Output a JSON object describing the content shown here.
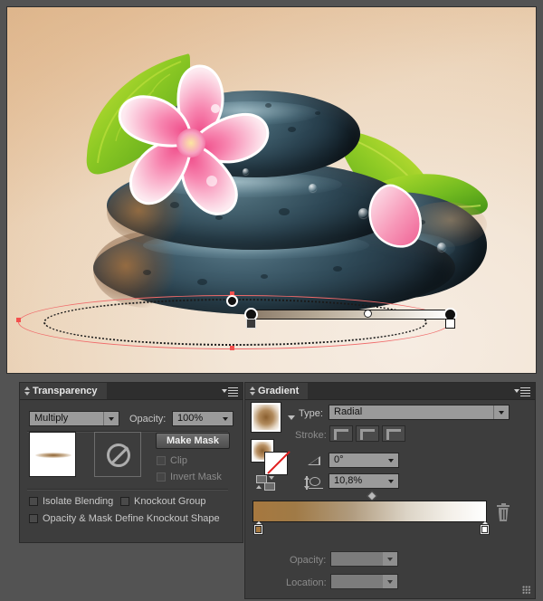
{
  "app": {
    "canvas_background": "#535353",
    "artboard_gradient_from": "#f6ece2",
    "artboard_gradient_to": "#dcb88f"
  },
  "artwork": {
    "name": "zen-stones-frangipani-illustration",
    "description": "Stack of dark blue-grey zen stones with a pink plumeria flower and green leaves on a warm beige radial gradient background",
    "selection_color": "#f4504e",
    "annotator": {
      "gradient_bar_from": "#8a7a68",
      "gradient_bar_to": "#ffffff"
    }
  },
  "transparency_panel": {
    "tab_label": "Transparency",
    "menu_icon": "panel-menu-icon",
    "blend_mode": {
      "value": "Multiply",
      "icon": "chevron-down-icon"
    },
    "opacity": {
      "label": "Opacity:",
      "value": "100%",
      "icon": "chevron-down-icon"
    },
    "thumbnails": {
      "artwork_thumb": "artwork-thumbnail",
      "mask_thumb": "mask-thumbnail",
      "mask_empty_icon": "no-entry-icon"
    },
    "make_mask_label": "Make Mask",
    "clip": {
      "label": "Clip",
      "checked": false,
      "enabled": false
    },
    "invert_mask": {
      "label": "Invert Mask",
      "checked": false,
      "enabled": false
    },
    "isolate_blending": {
      "label": "Isolate Blending",
      "checked": false
    },
    "knockout_group": {
      "label": "Knockout Group",
      "checked": false
    },
    "opacity_mask_define": {
      "label": "Opacity & Mask Define Knockout Shape",
      "checked": false
    }
  },
  "gradient_panel": {
    "tab_label": "Gradient",
    "menu_icon": "panel-menu-icon",
    "fill_swatch_name": "gradient-fill-swatch",
    "fill_swatch_arrow": "chevron-down-icon",
    "fill_stroke_name": "fill-stroke-indicator",
    "reverse_icon": "reverse-gradient-icon",
    "type": {
      "label": "Type:",
      "value": "Radial",
      "icon": "chevron-down-icon"
    },
    "stroke": {
      "label": "Stroke:",
      "enabled": false,
      "options": [
        "apply-gradient-within-stroke",
        "apply-gradient-along-stroke",
        "apply-gradient-across-stroke"
      ]
    },
    "angle": {
      "icon": "angle-icon",
      "value": "0°",
      "dropdown_icon": "chevron-down-icon"
    },
    "aspect_ratio": {
      "icon": "aspect-ratio-icon",
      "value": "10,8%",
      "dropdown_icon": "chevron-down-icon"
    },
    "gradient_slider": {
      "stop_left_color": "#a6783f",
      "stop_right_color": "#ffffff",
      "midpoint_name": "gradient-midpoint-diamond",
      "delete_icon": "trash-icon"
    },
    "stop_opacity": {
      "label": "Opacity:",
      "value": "",
      "enabled": false,
      "icon": "chevron-down-icon"
    },
    "stop_location": {
      "label": "Location:",
      "value": "",
      "enabled": false,
      "icon": "chevron-down-icon"
    },
    "resize_grip": "resize-grip-icon"
  }
}
